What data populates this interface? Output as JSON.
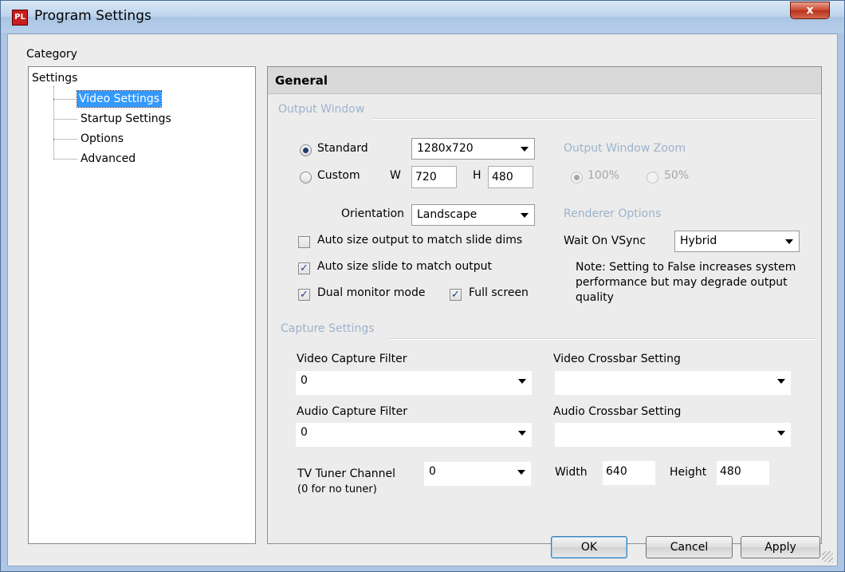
{
  "window": {
    "title": "Program Settings",
    "app_icon_text": "PL",
    "close_glyph": "x"
  },
  "category_label": "Category",
  "tree": {
    "root": "Settings",
    "items": [
      {
        "label": "Video Settings",
        "selected": true
      },
      {
        "label": "Startup Settings",
        "selected": false
      },
      {
        "label": "Options",
        "selected": false
      },
      {
        "label": "Advanced",
        "selected": false
      }
    ]
  },
  "panel": {
    "header": "General",
    "output_window": {
      "group_title": "Output Window",
      "standard_label": "Standard",
      "resolution_value": "1280x720",
      "custom_label": "Custom",
      "w_label": "W",
      "w_value": "720",
      "h_label": "H",
      "h_value": "480",
      "orientation_label": "Orientation",
      "orientation_value": "Landscape",
      "auto_size_output_label": "Auto size output to match slide dims",
      "auto_size_slide_label": "Auto size slide to match output",
      "dual_monitor_label": "Dual monitor mode",
      "full_screen_label": "Full screen",
      "checked_glyph": "✓"
    },
    "zoom": {
      "group_title": "Output Window Zoom",
      "option_100": "100%",
      "option_50": "50%"
    },
    "renderer": {
      "group_title": "Renderer Options",
      "vsync_label": "Wait On VSync",
      "vsync_value": "Hybrid",
      "note": "Note: Setting to False increases system performance but may degrade output quality"
    },
    "capture": {
      "group_title": "Capture Settings",
      "video_filter_label": "Video Capture Filter",
      "video_filter_value": "0",
      "video_crossbar_label": "Video Crossbar Setting",
      "video_crossbar_value": "",
      "audio_filter_label": "Audio Capture Filter",
      "audio_filter_value": "0",
      "audio_crossbar_label": "Audio Crossbar Setting",
      "audio_crossbar_value": "",
      "tuner_label": "TV Tuner Channel",
      "tuner_sublabel": "(0 for no tuner)",
      "tuner_value": "0",
      "width_label": "Width",
      "width_value": "640",
      "height_label": "Height",
      "height_value": "480"
    }
  },
  "buttons": {
    "ok": "OK",
    "cancel": "Cancel",
    "apply": "Apply"
  },
  "colors": {
    "title_bar": "#bcd3ec",
    "selection": "#3399ff",
    "group_title": "#9db3cc",
    "close_button": "#c9472f"
  }
}
